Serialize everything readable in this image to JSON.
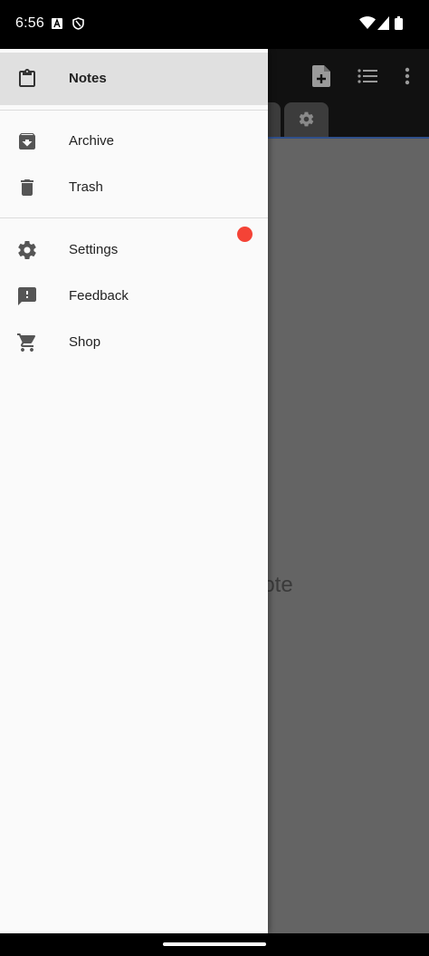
{
  "status_bar": {
    "time": "6:56",
    "left_icons": [
      "app-notification-icon",
      "shield-icon"
    ],
    "right_icons": [
      "wifi-icon",
      "signal-icon",
      "battery-icon"
    ]
  },
  "background_app": {
    "toolbar_icons": [
      "add-note-icon",
      "list-view-icon",
      "more-vert-icon"
    ],
    "empty_message_partial": "ote"
  },
  "drawer": {
    "items": [
      {
        "id": "notes",
        "label": "Notes",
        "icon": "clipboard-icon",
        "selected": true
      },
      {
        "id": "archive",
        "label": "Archive",
        "icon": "archive-icon",
        "selected": false
      },
      {
        "id": "trash",
        "label": "Trash",
        "icon": "trash-icon",
        "selected": false
      },
      {
        "id": "settings",
        "label": "Settings",
        "icon": "gear-icon",
        "selected": false,
        "badge": true
      },
      {
        "id": "feedback",
        "label": "Feedback",
        "icon": "feedback-icon",
        "selected": false
      },
      {
        "id": "shop",
        "label": "Shop",
        "icon": "cart-icon",
        "selected": false
      }
    ]
  },
  "colors": {
    "drawer_bg": "#fafafa",
    "selected_bg": "#e0e0e0",
    "badge": "#f44336",
    "scrim": "#646464",
    "toolbar": "#111111"
  }
}
